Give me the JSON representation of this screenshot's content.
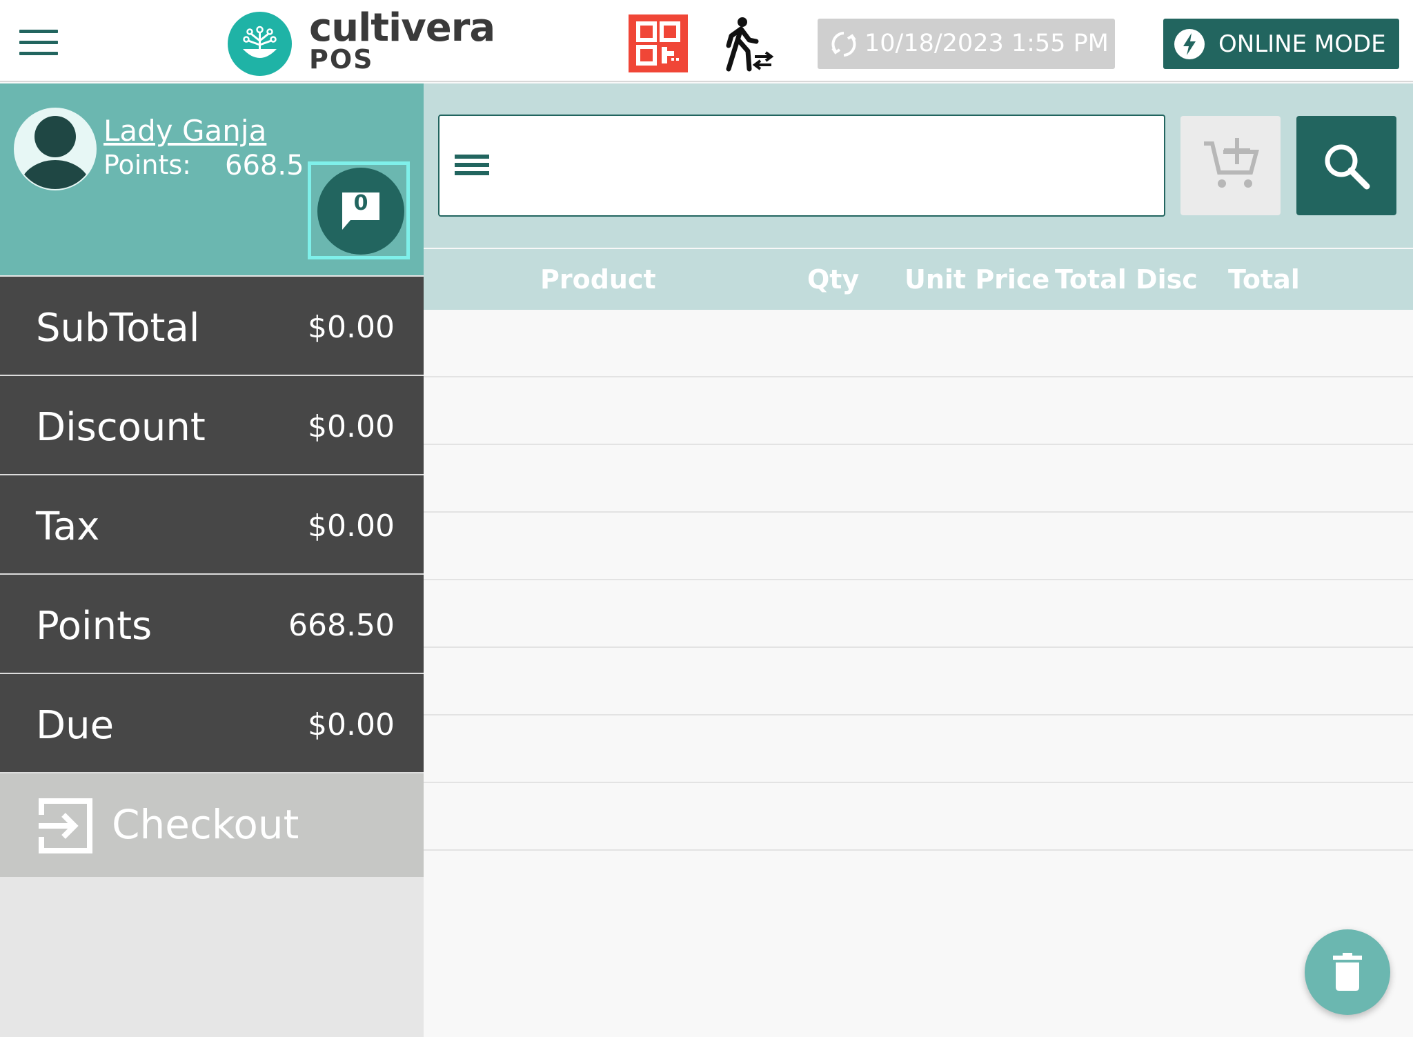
{
  "header": {
    "logo_name": "cultivera",
    "logo_sub": "POS",
    "sync_datetime": "10/18/2023 1:55 PM",
    "online_mode_label": "ONLINE MODE"
  },
  "customer": {
    "name": "Lady Ganja",
    "points_label": "Points:",
    "points_value": "668.5",
    "message_count": "0"
  },
  "totals": [
    {
      "label": "SubTotal",
      "value": "$0.00"
    },
    {
      "label": "Discount",
      "value": "$0.00"
    },
    {
      "label": "Tax",
      "value": "$0.00"
    },
    {
      "label": "Points",
      "value": "668.50"
    },
    {
      "label": "Due",
      "value": "$0.00"
    }
  ],
  "checkout_label": "Checkout",
  "search": {
    "value": "",
    "placeholder": ""
  },
  "table": {
    "columns": [
      "Product",
      "Qty",
      "Unit Price",
      "Total Disc",
      "Total"
    ],
    "rows": []
  },
  "colors": {
    "brand_dark": "#22655f",
    "brand_light": "#6bb7b0",
    "panel_dark": "#474747",
    "qr_red": "#f04637",
    "header_teal": "#c2dcdb"
  },
  "icons": {
    "menu": "menu-icon",
    "qr": "qr-code-icon",
    "walk_in": "walk-in-transfer-icon",
    "sync": "sync-icon",
    "online": "lightning-bolt-icon",
    "avatar": "avatar-icon",
    "message": "chat-bubble-icon",
    "checkout": "exit-arrow-icon",
    "add_cart": "add-to-cart-icon",
    "search": "search-icon",
    "trash": "trash-icon"
  }
}
